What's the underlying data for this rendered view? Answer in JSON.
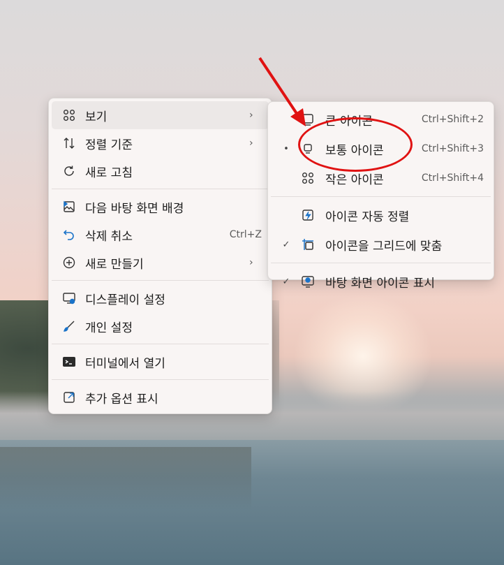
{
  "main_menu": {
    "items": [
      {
        "label": "보기",
        "icon": "grid-icon",
        "submenu": true
      },
      {
        "label": "정렬 기준",
        "icon": "sort-icon",
        "submenu": true
      },
      {
        "label": "새로 고침",
        "icon": "refresh-icon"
      },
      {
        "label": "다음 바탕 화면 배경",
        "icon": "next-wallpaper-icon"
      },
      {
        "label": "삭제 취소",
        "shortcut": "Ctrl+Z",
        "icon": "undo-icon"
      },
      {
        "label": "새로 만들기",
        "icon": "new-icon",
        "submenu": true
      },
      {
        "label": "디스플레이 설정",
        "icon": "display-settings-icon"
      },
      {
        "label": "개인 설정",
        "icon": "brush-icon"
      },
      {
        "label": "터미널에서 열기",
        "icon": "terminal-icon"
      },
      {
        "label": "추가 옵션 표시",
        "icon": "show-more-icon"
      }
    ]
  },
  "view_submenu": {
    "items": [
      {
        "label": "큰 아이콘",
        "shortcut": "Ctrl+Shift+2",
        "icon": "large-icons-icon",
        "mark": ""
      },
      {
        "label": "보통 아이콘",
        "shortcut": "Ctrl+Shift+3",
        "icon": "medium-icons-icon",
        "mark": "•"
      },
      {
        "label": "작은 아이콘",
        "shortcut": "Ctrl+Shift+4",
        "icon": "small-icons-icon",
        "mark": ""
      },
      {
        "label": "아이콘 자동 정렬",
        "icon": "auto-arrange-icon",
        "mark": ""
      },
      {
        "label": "아이콘을 그리드에 맞춤",
        "icon": "align-grid-icon",
        "mark": "✓"
      },
      {
        "label": "바탕 화면 아이콘 표시",
        "icon": "show-desktop-icons-icon",
        "mark": "✓"
      }
    ]
  },
  "colors": {
    "annotation": "#e01212",
    "accent": "#1a73c9"
  }
}
